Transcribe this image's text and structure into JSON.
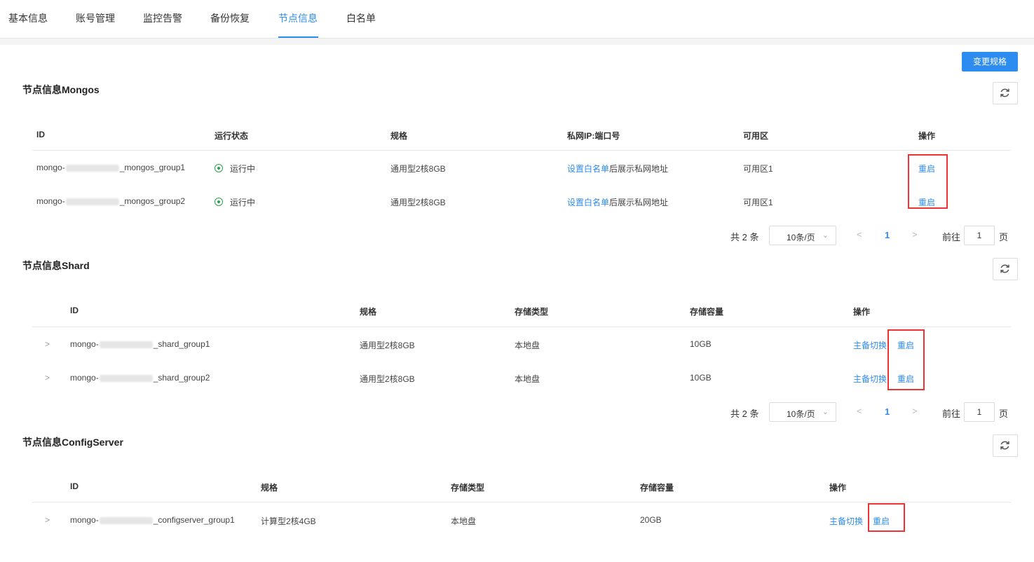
{
  "tabs": [
    {
      "label": "基本信息",
      "active": false
    },
    {
      "label": "账号管理",
      "active": false
    },
    {
      "label": "监控告警",
      "active": false
    },
    {
      "label": "备份恢复",
      "active": false
    },
    {
      "label": "节点信息",
      "active": true
    },
    {
      "label": "白名单",
      "active": false
    }
  ],
  "change_spec_button": "变更规格",
  "mongos": {
    "title": "节点信息Mongos",
    "columns": [
      "ID",
      "运行状态",
      "规格",
      "私网IP:端口号",
      "可用区",
      "操作"
    ],
    "rows": [
      {
        "id_prefix": "mongo-",
        "id_suffix": "_mongos_group1",
        "status": "运行中",
        "spec": "通用型2核8GB",
        "ip_link": "设置白名单",
        "ip_text": "后展示私网地址",
        "zone": "可用区1",
        "action": "重启"
      },
      {
        "id_prefix": "mongo-",
        "id_suffix": "_mongos_group2",
        "status": "运行中",
        "spec": "通用型2核8GB",
        "ip_link": "设置白名单",
        "ip_text": "后展示私网地址",
        "zone": "可用区1",
        "action": "重启"
      }
    ],
    "pager": {
      "total": "共 2 条",
      "page_size": "10条/页",
      "current_page": "1",
      "goto_label": "前往",
      "goto_value": "1",
      "goto_suffix": "页"
    }
  },
  "shard": {
    "title": "节点信息Shard",
    "columns": [
      "ID",
      "规格",
      "存储类型",
      "存储容量",
      "操作"
    ],
    "rows": [
      {
        "id_prefix": "mongo-",
        "id_suffix": "_shard_group1",
        "spec": "通用型2核8GB",
        "storage_type": "本地盘",
        "capacity": "10GB",
        "switch": "主备切换",
        "action": "重启"
      },
      {
        "id_prefix": "mongo-",
        "id_suffix": "_shard_group2",
        "spec": "通用型2核8GB",
        "storage_type": "本地盘",
        "capacity": "10GB",
        "switch": "主备切换",
        "action": "重启"
      }
    ],
    "pager": {
      "total": "共 2 条",
      "page_size": "10条/页",
      "current_page": "1",
      "goto_label": "前往",
      "goto_value": "1",
      "goto_suffix": "页"
    }
  },
  "configserver": {
    "title": "节点信息ConfigServer",
    "columns": [
      "ID",
      "规格",
      "存储类型",
      "存储容量",
      "操作"
    ],
    "rows": [
      {
        "id_prefix": "mongo-",
        "id_suffix": "_configserver_group1",
        "spec": "计算型2核4GB",
        "storage_type": "本地盘",
        "capacity": "20GB",
        "switch": "主备切换",
        "action": "重启"
      }
    ]
  },
  "colors": {
    "accent": "#2d8cf0",
    "running": "#2ea44f",
    "highlight": "#e33333"
  }
}
